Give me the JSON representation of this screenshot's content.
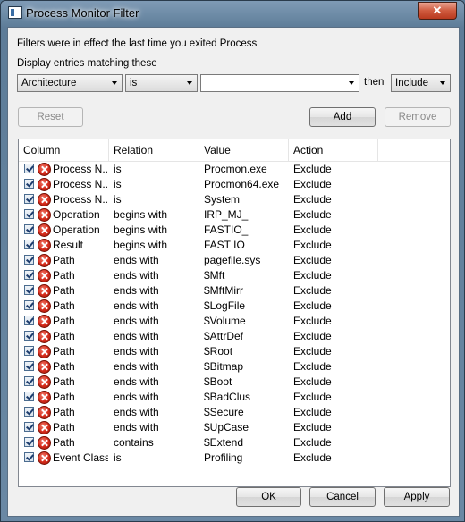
{
  "window": {
    "title": "Process Monitor Filter",
    "close_label": "✕"
  },
  "info_text": "Filters were in effect the last time you exited Process",
  "match_label": "Display entries matching these",
  "filter_builder": {
    "column": "Architecture",
    "relation": "is",
    "value": "",
    "then_label": "then",
    "action": "Include"
  },
  "buttons": {
    "reset": "Reset",
    "add": "Add",
    "remove": "Remove",
    "ok": "OK",
    "cancel": "Cancel",
    "apply": "Apply"
  },
  "table": {
    "headers": [
      "Column",
      "Relation",
      "Value",
      "Action"
    ],
    "rows": [
      {
        "column": "Process N...",
        "relation": "is",
        "value": "Procmon.exe",
        "action": "Exclude"
      },
      {
        "column": "Process N...",
        "relation": "is",
        "value": "Procmon64.exe",
        "action": "Exclude"
      },
      {
        "column": "Process N...",
        "relation": "is",
        "value": "System",
        "action": "Exclude"
      },
      {
        "column": "Operation",
        "relation": "begins with",
        "value": "IRP_MJ_",
        "action": "Exclude"
      },
      {
        "column": "Operation",
        "relation": "begins with",
        "value": "FASTIO_",
        "action": "Exclude"
      },
      {
        "column": "Result",
        "relation": "begins with",
        "value": "FAST IO",
        "action": "Exclude"
      },
      {
        "column": "Path",
        "relation": "ends with",
        "value": "pagefile.sys",
        "action": "Exclude"
      },
      {
        "column": "Path",
        "relation": "ends with",
        "value": "$Mft",
        "action": "Exclude"
      },
      {
        "column": "Path",
        "relation": "ends with",
        "value": "$MftMirr",
        "action": "Exclude"
      },
      {
        "column": "Path",
        "relation": "ends with",
        "value": "$LogFile",
        "action": "Exclude"
      },
      {
        "column": "Path",
        "relation": "ends with",
        "value": "$Volume",
        "action": "Exclude"
      },
      {
        "column": "Path",
        "relation": "ends with",
        "value": "$AttrDef",
        "action": "Exclude"
      },
      {
        "column": "Path",
        "relation": "ends with",
        "value": "$Root",
        "action": "Exclude"
      },
      {
        "column": "Path",
        "relation": "ends with",
        "value": "$Bitmap",
        "action": "Exclude"
      },
      {
        "column": "Path",
        "relation": "ends with",
        "value": "$Boot",
        "action": "Exclude"
      },
      {
        "column": "Path",
        "relation": "ends with",
        "value": "$BadClus",
        "action": "Exclude"
      },
      {
        "column": "Path",
        "relation": "ends with",
        "value": "$Secure",
        "action": "Exclude"
      },
      {
        "column": "Path",
        "relation": "ends with",
        "value": "$UpCase",
        "action": "Exclude"
      },
      {
        "column": "Path",
        "relation": "contains",
        "value": "$Extend",
        "action": "Exclude"
      },
      {
        "column": "Event Class",
        "relation": "is",
        "value": "Profiling",
        "action": "Exclude"
      }
    ]
  }
}
